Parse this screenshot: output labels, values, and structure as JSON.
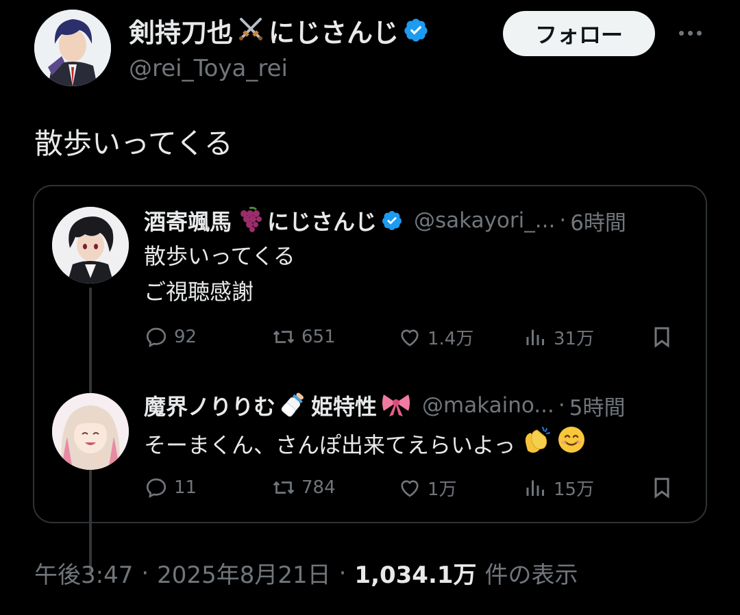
{
  "author": {
    "name": "剣持刀也⚔️にじさんじ",
    "name_text": "剣持刀也",
    "name_suffix": "にじさんじ",
    "handle": "@rei_Toya_rei",
    "verified": true
  },
  "follow_label": "フォロー",
  "tweet_text": "散歩いってくる",
  "thread": [
    {
      "name_text": "酒寄颯馬",
      "name_suffix": "にじさんじ",
      "handle": "@sakayori_...",
      "sep": "·",
      "time": "6時間",
      "lines": [
        "散歩いってくる",
        "ご視聴感謝"
      ],
      "replies": "92",
      "reposts": "651",
      "likes": "1.4万",
      "views": "31万"
    },
    {
      "name_text": "魔界ノりりむ",
      "name_suffix": "姫特性",
      "handle": "@makaino...",
      "sep": "·",
      "time": "5時間",
      "lines": [
        "そーまくん、さんぽ出来てえらいよっ"
      ],
      "replies": "11",
      "reposts": "784",
      "likes": "1万",
      "views": "15万"
    }
  ],
  "meta": {
    "time": "午後3:47",
    "sep": "·",
    "date": "2025年8月21日",
    "views_count": "1,034.1万",
    "views_label": "件の表示"
  },
  "colors": {
    "background": "#000000",
    "text": "#e7e9ea",
    "muted": "#71767b",
    "verified": "#1d9bf0",
    "border": "#2f3336"
  },
  "icons": [
    "crossed-swords-icon",
    "grapes-icon",
    "baby-bottle-icon",
    "ribbon-icon",
    "clapping-hands-icon",
    "smile-icon",
    "verified-badge-icon",
    "reply-icon",
    "repost-icon",
    "like-icon",
    "views-icon",
    "bookmark-icon",
    "more-icon"
  ]
}
